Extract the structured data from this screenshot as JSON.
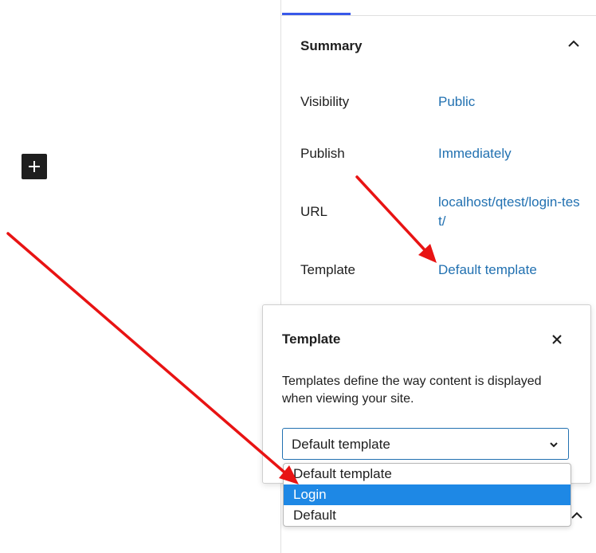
{
  "canvas": {
    "add_block_icon": "plus-icon"
  },
  "sidebar": {
    "summary_title": "Summary",
    "rows": [
      {
        "label": "Visibility",
        "value": "Public"
      },
      {
        "label": "Publish",
        "value": "Immediately"
      },
      {
        "label": "URL",
        "value": "localhost/qtest/login-test/"
      },
      {
        "label": "Template",
        "value": "Default template"
      }
    ]
  },
  "popover": {
    "title": "Template",
    "help_text": "Templates define the way content is displayed when viewing your site.",
    "select_value": "Default template",
    "options": [
      "Default template",
      "Login",
      "Default"
    ],
    "highlighted_option": "Login"
  },
  "colors": {
    "link": "#2271b1",
    "highlight": "#1e88e5",
    "annotation_arrow": "#e81313"
  }
}
